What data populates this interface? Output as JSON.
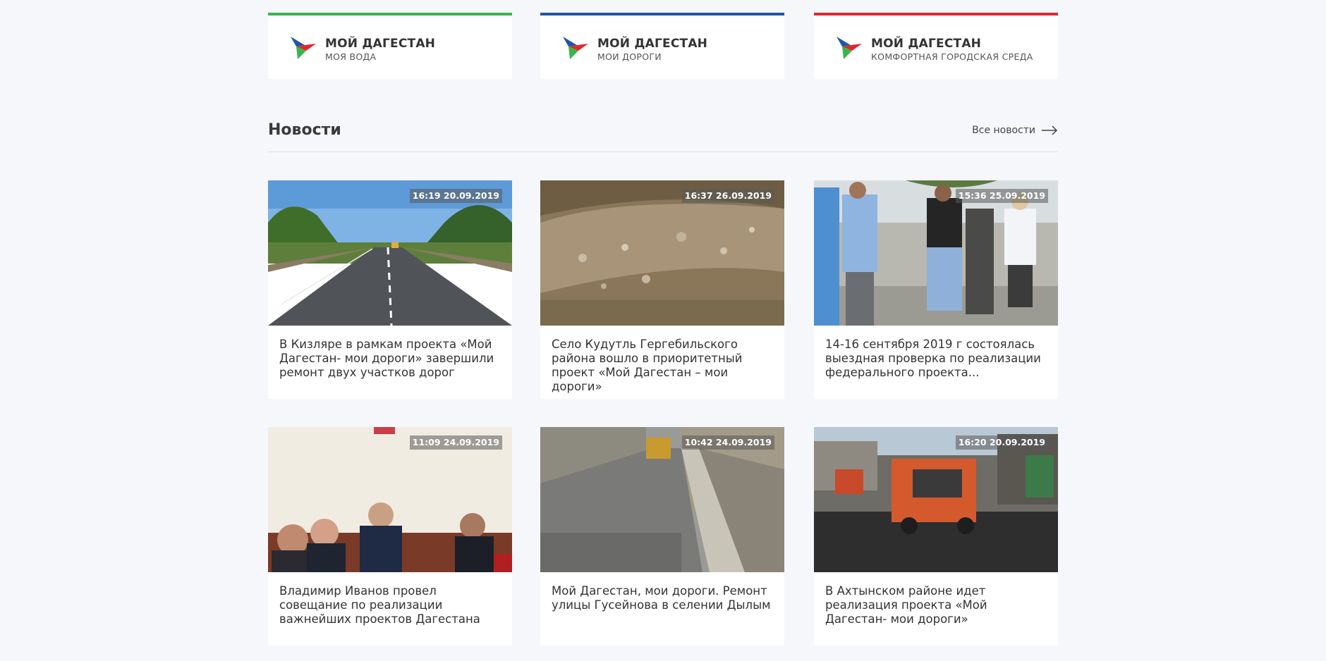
{
  "projects": [
    {
      "title": "МОЙ ДАГЕСТАН",
      "subtitle": "МОЯ ВОДА",
      "accent": "#3bb54a"
    },
    {
      "title": "МОЙ ДАГЕСТАН",
      "subtitle": "МОИ ДОРОГИ",
      "accent": "#1f57a8"
    },
    {
      "title": "МОЙ ДАГЕСТАН",
      "subtitle": "КОМФОРТНАЯ ГОРОДСКАЯ СРЕДА",
      "accent": "#e3262c"
    }
  ],
  "news": {
    "title": "Новости",
    "all_label": "Все новости",
    "items": [
      {
        "time": "16:19 20.09.2019",
        "text": "В Кизляре в рамкам проекта «Мой Дагестан- мои дороги» завершили ремонт двух участков дорог"
      },
      {
        "time": "16:37 26.09.2019",
        "text": "Село Кудутль Гергебильского района вошло в приоритетный проект «Мой Дагестан – мои дороги»"
      },
      {
        "time": "15:36 25.09.2019",
        "text": "14-16 сентября 2019 г состоялась выездная проверка по реализации федерального проекта..."
      },
      {
        "time": "11:09 24.09.2019",
        "text": "Владимир Иванов провел совещание по реализации важнейших проектов Дагестана"
      },
      {
        "time": "10:42 24.09.2019",
        "text": "Мой Дагестан, мои дороги. Ремонт улицы Гусейнова в селении Дылым"
      },
      {
        "time": "16:20 20.09.2019",
        "text": "В Ахтынском районе идет реализация проекта «Мой Дагестан- мои дороги»"
      }
    ]
  },
  "icons": {
    "logo": "dagestan-flag-arrow-logo",
    "arrow": "arrow-right-icon"
  }
}
